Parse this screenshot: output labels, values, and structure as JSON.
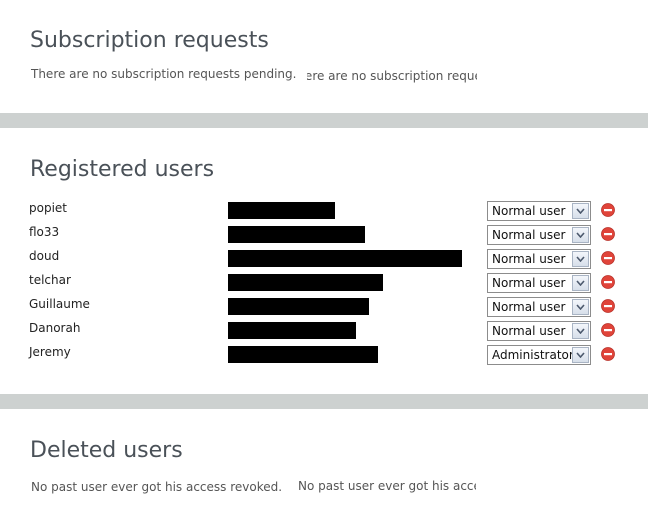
{
  "subscription": {
    "title": "Subscription requests",
    "empty_message": "There are no subscription requests pending.",
    "empty_message_clipped": "There are no subscription requests pending."
  },
  "registered": {
    "title": "Registered users",
    "users": [
      {
        "name": "popiet",
        "role": "Normal user"
      },
      {
        "name": "flo33",
        "role": "Normal user"
      },
      {
        "name": "doud",
        "role": "Normal user"
      },
      {
        "name": "telchar",
        "role": "Normal user"
      },
      {
        "name": "Guillaume",
        "role": "Normal user"
      },
      {
        "name": "Danorah",
        "role": "Normal user"
      },
      {
        "name": "Jeremy",
        "role": "Administrator"
      }
    ]
  },
  "deleted": {
    "title": "Deleted users",
    "empty_message": "No past user ever got his access revoked.",
    "empty_message_clipped": "No past user ever got his access revoked."
  },
  "icons": {
    "remove": "remove-circle-icon",
    "dropdown": "chevron-down-icon"
  },
  "colors": {
    "divider": "#cdd1d0",
    "remove_icon": "#e0443a",
    "title": "#4a5158"
  }
}
